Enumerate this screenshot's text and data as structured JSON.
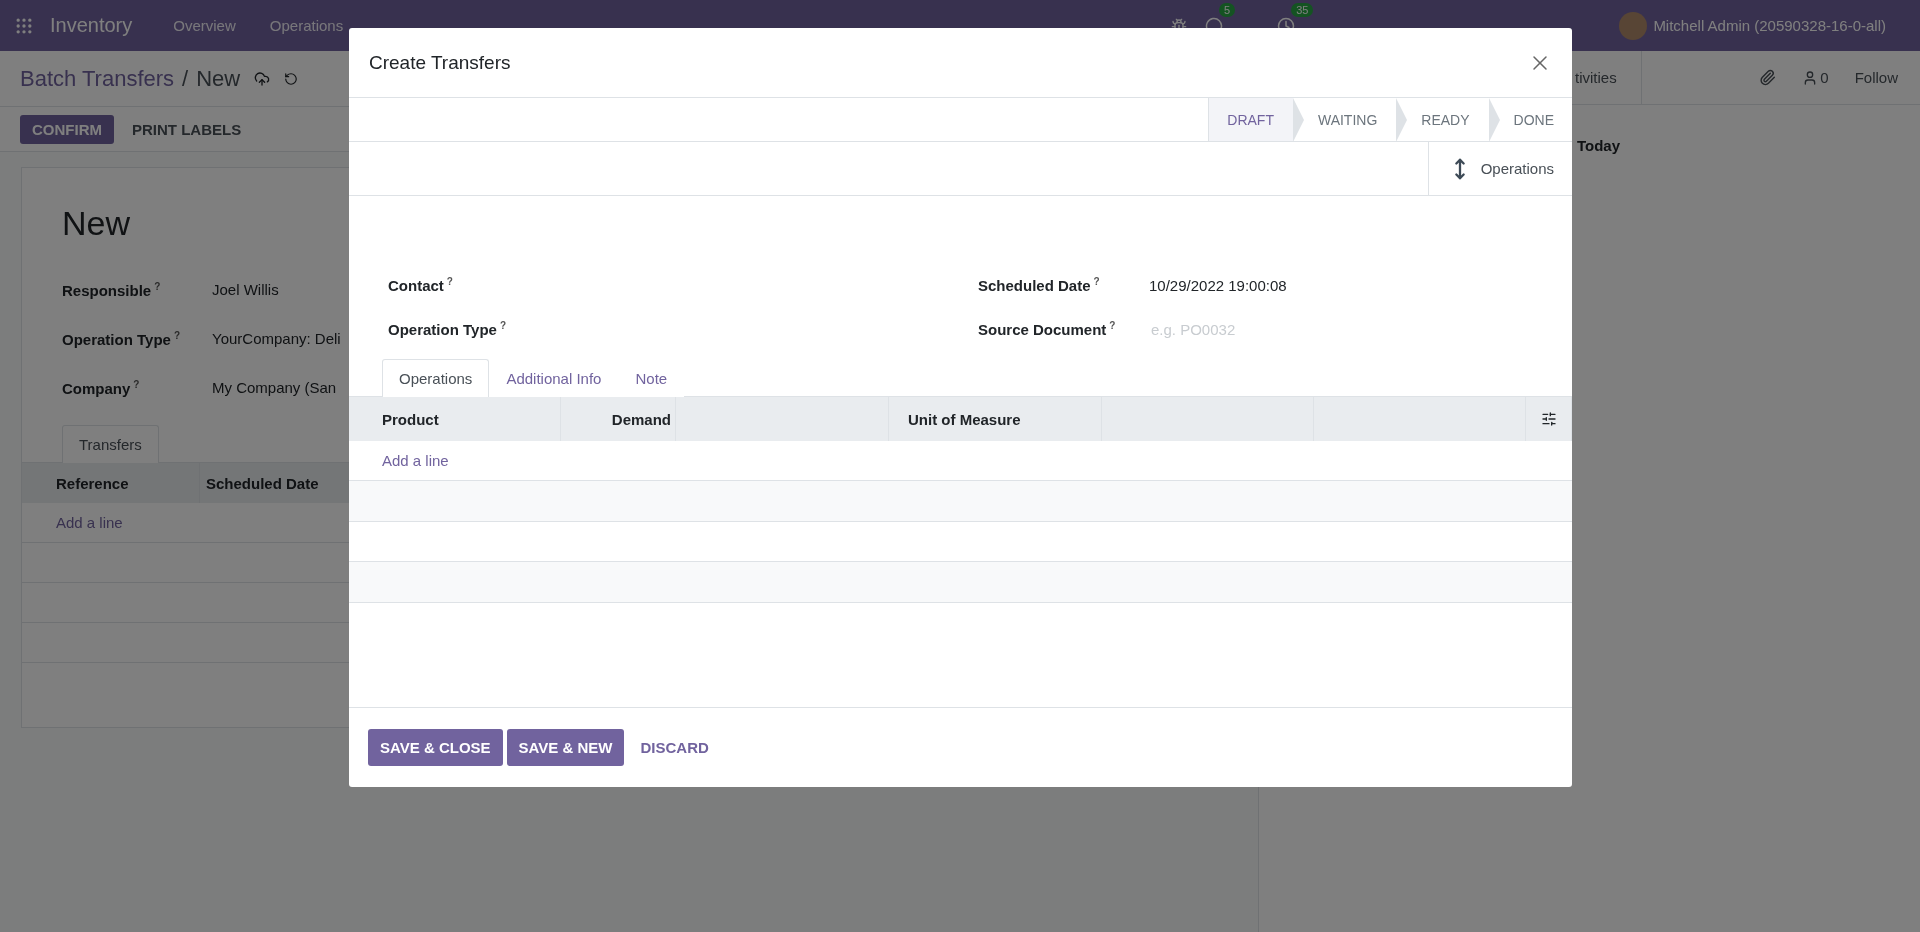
{
  "navbar": {
    "app": "Inventory",
    "menus": [
      "Overview",
      "Operations"
    ],
    "messages_badge": "5",
    "activities_badge": "35",
    "user": "Mitchell Admin (20590328-16-0-all)"
  },
  "breadcrumb": {
    "parent": "Batch Transfers",
    "separator": "/",
    "current": "New"
  },
  "actions": [
    {
      "label": "CONFIRM",
      "kind": "primary"
    },
    {
      "label": "PRINT LABELS",
      "kind": "secondary"
    }
  ],
  "sheet": {
    "title": "New",
    "fields": [
      {
        "label": "Responsible",
        "help": "?",
        "value": "Joel Willis"
      },
      {
        "label": "Operation Type",
        "help": "?",
        "value": "YourCompany: Deli"
      },
      {
        "label": "Company",
        "help": "?",
        "value": "My Company (San"
      }
    ],
    "tabs": [
      {
        "label": "Transfers",
        "selected": true
      }
    ],
    "columns": [
      "Reference",
      "Scheduled Date"
    ],
    "add_line": "Add a line"
  },
  "chatter": {
    "activities": "tivities",
    "followers": "0",
    "follow": "Follow",
    "date_group": "Today"
  },
  "dialog": {
    "title": "Create Transfers",
    "statuses": [
      {
        "label": "DRAFT",
        "selected": true
      },
      {
        "label": "WAITING",
        "selected": false
      },
      {
        "label": "READY",
        "selected": false
      },
      {
        "label": "DONE",
        "selected": false
      }
    ],
    "smart_button": "Operations",
    "fields_left": [
      {
        "label": "Contact",
        "help": "?"
      },
      {
        "label": "Operation Type",
        "help": "?"
      }
    ],
    "fields_right": [
      {
        "label": "Scheduled Date",
        "help": "?",
        "value": "10/29/2022 19:00:08"
      },
      {
        "label": "Source Document",
        "help": "?",
        "placeholder": "e.g. PO0032"
      }
    ],
    "tabs": [
      {
        "label": "Operations",
        "selected": true
      },
      {
        "label": "Additional Info",
        "selected": false
      },
      {
        "label": "Note",
        "selected": false
      }
    ],
    "columns": [
      {
        "label": "Product",
        "kind": "text"
      },
      {
        "label": "Demand",
        "kind": "number"
      },
      {
        "label": "Unit of Measure",
        "kind": "text"
      }
    ],
    "add_line": "Add a line",
    "buttons": [
      {
        "label": "SAVE & CLOSE",
        "kind": "primary"
      },
      {
        "label": "SAVE & NEW",
        "kind": "primary"
      },
      {
        "label": "DISCARD",
        "kind": "link"
      }
    ]
  }
}
